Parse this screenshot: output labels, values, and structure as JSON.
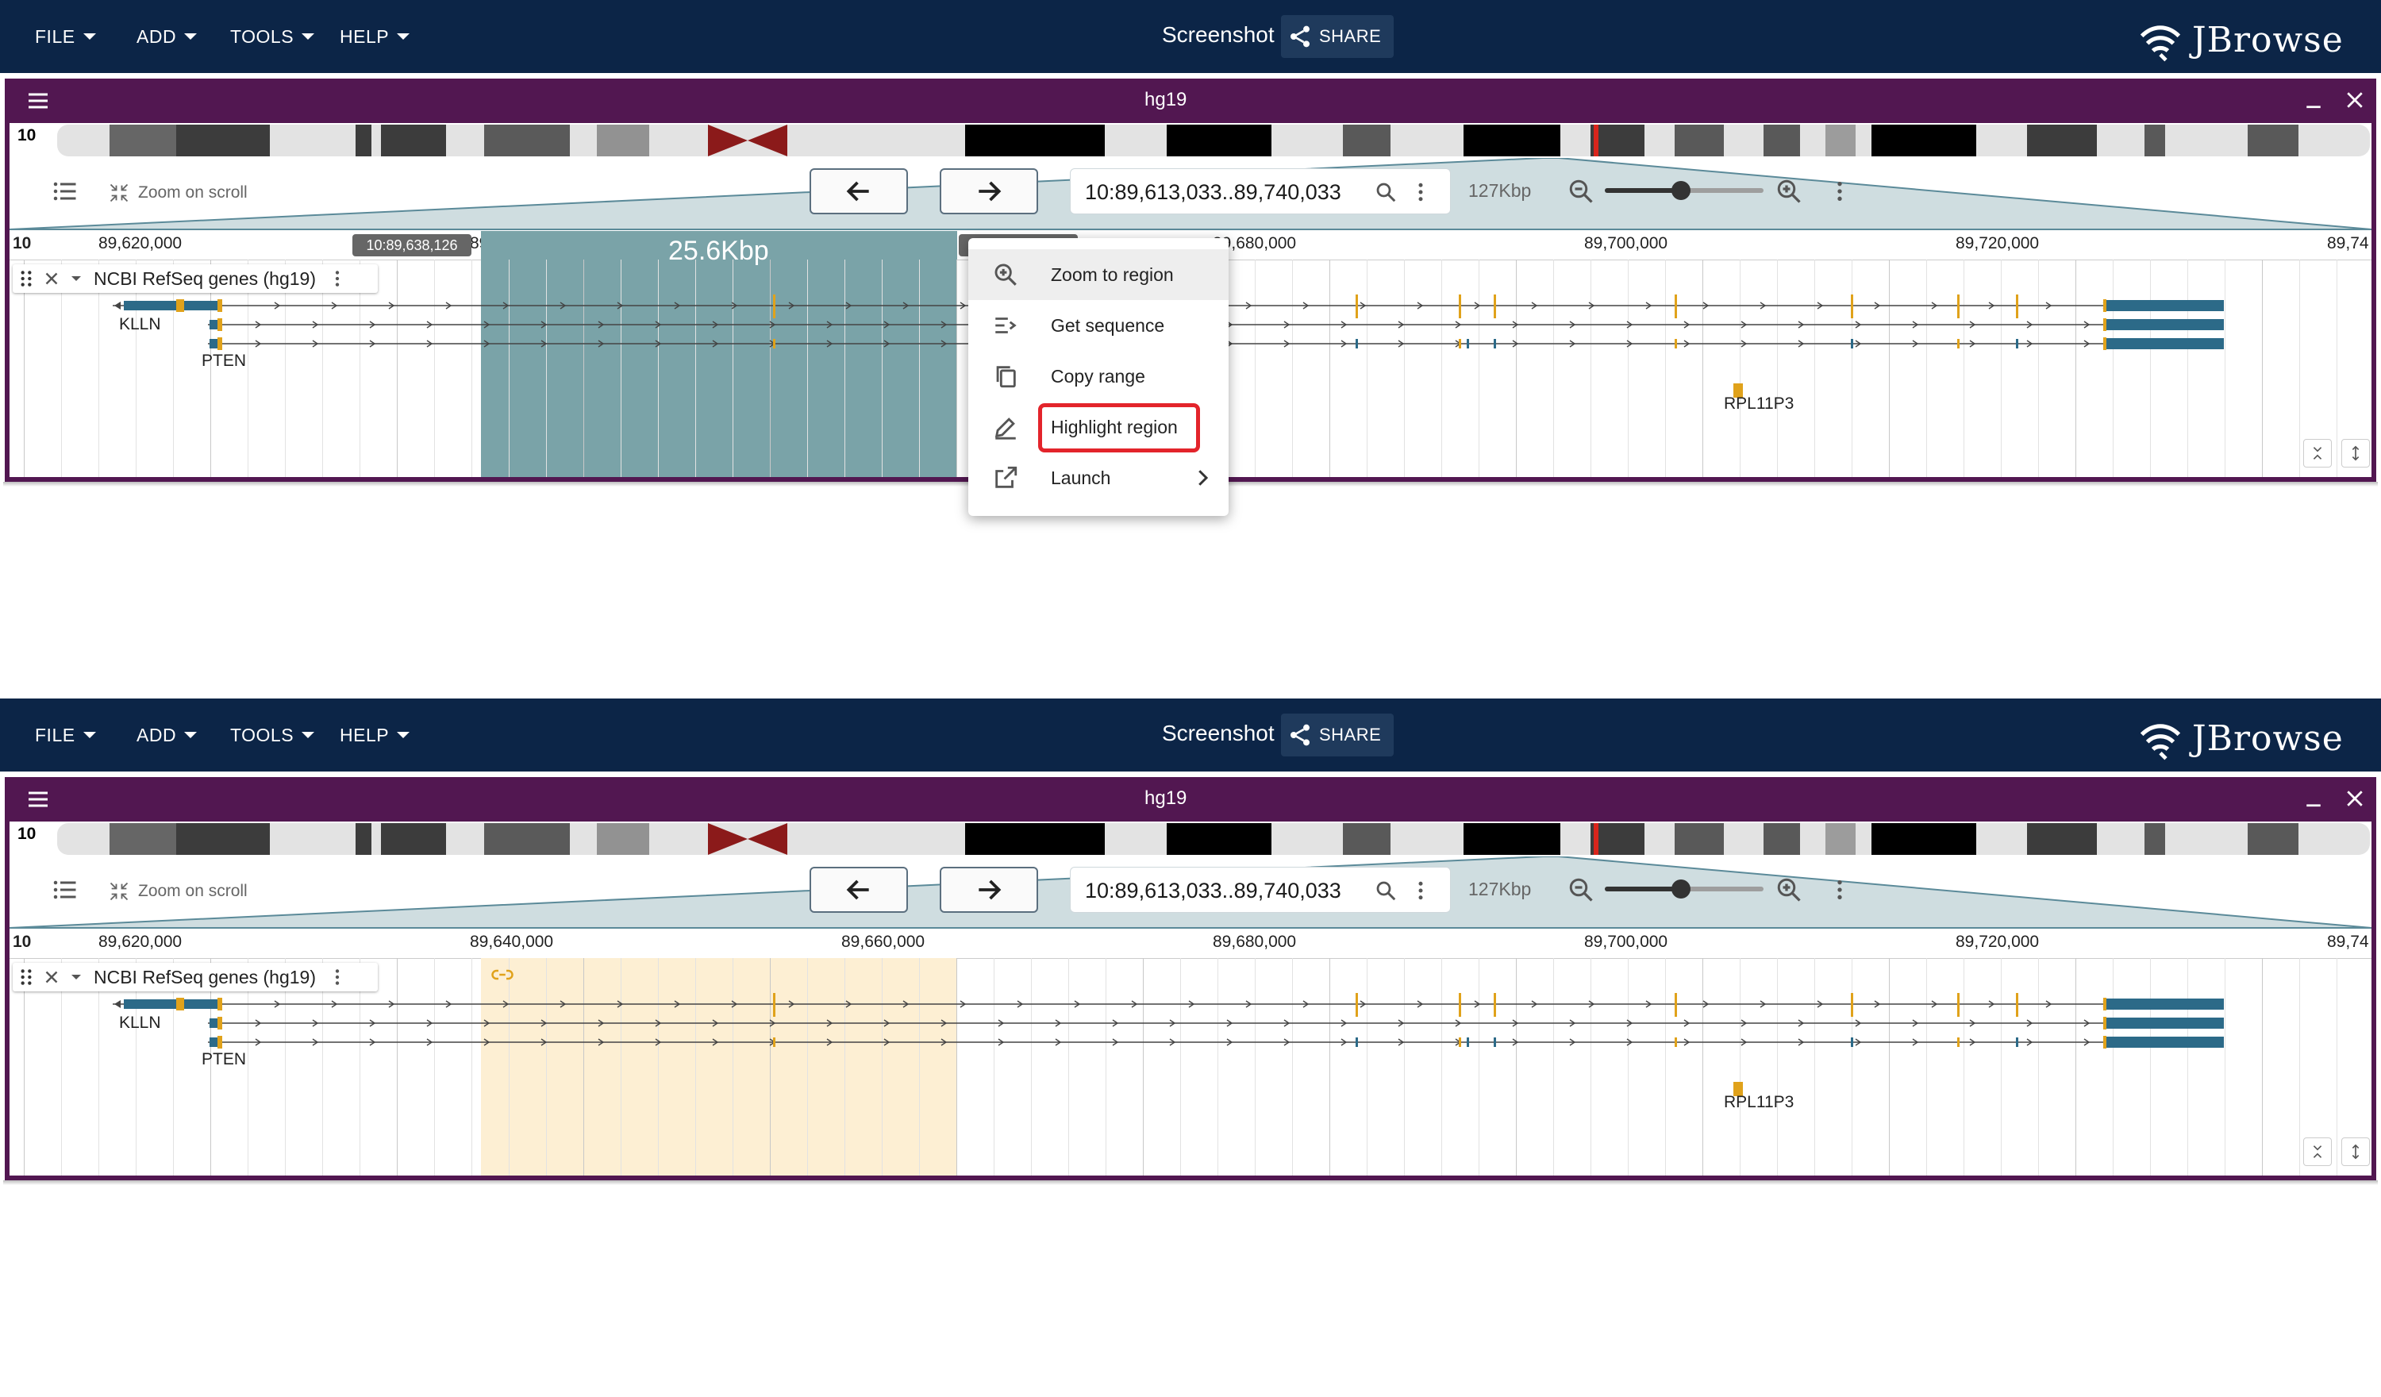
{
  "menus": [
    "FILE",
    "ADD",
    "TOOLS",
    "HELP"
  ],
  "screenshot_label": "Screenshot",
  "share_label": "SHARE",
  "logo_text": "JBrowse",
  "view": {
    "title": "hg19",
    "chromosome": "10",
    "zoom_on_scroll": "Zoom on scroll",
    "location": "10:89,613,033..89,740,033",
    "bp_per_view": "127Kbp",
    "ruler_chr": "10",
    "ruler_ticks": [
      "89,620,000",
      "89,640,000",
      "89,660,000",
      "89,680,000",
      "89,700,000",
      "89,720,000",
      "89,74"
    ],
    "track_name": "NCBI RefSeq genes (hg19)",
    "genes": [
      "KLLN",
      "PTEN",
      "RPL11P3"
    ]
  },
  "top_panel": {
    "selection_start": "10:89,638,126",
    "selection_size": "25.6Kbp",
    "context_menu": [
      "Zoom to region",
      "Get sequence",
      "Copy range",
      "Highlight region",
      "Launch"
    ],
    "highlighted_item": "Highlight region"
  },
  "colors": {
    "appbar": "#0c2547",
    "view_header": "#521751",
    "selection": "#7aa3a8",
    "highlight": "#fdefd3",
    "exon_blue": "#2c6a88",
    "exon_gold": "#e0a21b",
    "callout": "#e3242b"
  }
}
